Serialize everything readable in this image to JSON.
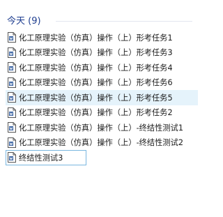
{
  "group": {
    "title": "今天 (9)"
  },
  "files": [
    {
      "label": "化工原理实验（仿真）操作（上）形考任务1",
      "icon": "document-icon"
    },
    {
      "label": "化工原理实验（仿真）操作（上）形考任务3",
      "icon": "document-icon"
    },
    {
      "label": "化工原理实验（仿真）操作（上）形考任务4",
      "icon": "document-icon"
    },
    {
      "label": "化工原理实验（仿真）操作（上）形考任务6",
      "icon": "document-icon"
    },
    {
      "label": "化工原理实验（仿真）操作（上）形考任务5",
      "icon": "document-icon",
      "state": "hovered"
    },
    {
      "label": "化工原理实验（仿真）操作（上）形考任务2",
      "icon": "document-icon"
    },
    {
      "label": "化工原理实验（仿真）操作（上）-终结性测试1",
      "icon": "document-icon"
    },
    {
      "label": "化工原理实验（仿真）操作（上）-终结性测试2",
      "icon": "document-icon"
    },
    {
      "label": "终结性测试3",
      "icon": "document-icon",
      "state": "focused"
    }
  ],
  "colors": {
    "group_title": "#1e3d8f",
    "hover_background": "#e5f3fb",
    "focus_border": "#7ab7e0",
    "icon_accent": "#2b579a"
  }
}
